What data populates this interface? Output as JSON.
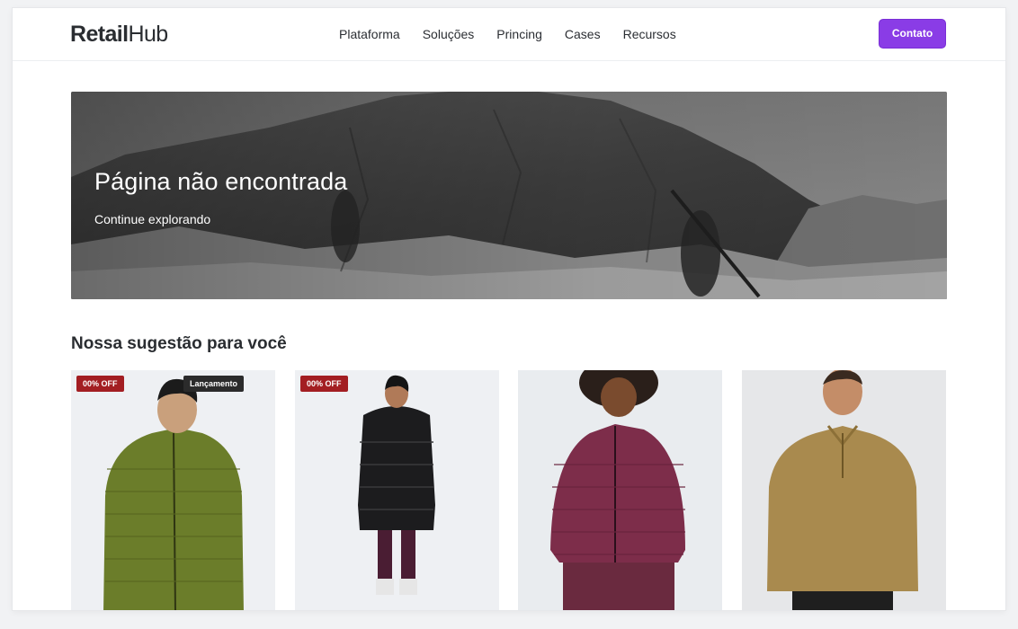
{
  "header": {
    "logo": {
      "part1": "Retail",
      "part2": "Hub"
    },
    "nav": [
      "Plataforma",
      "Soluções",
      "Princing",
      "Cases",
      "Recursos"
    ],
    "contact_label": "Contato"
  },
  "hero": {
    "title": "Página não encontrada",
    "subtitle": "Continue explorando"
  },
  "suggestions": {
    "title": "Nossa sugestão para você",
    "products": [
      {
        "badge_discount": "00% OFF",
        "badge_new": "Lançamento",
        "product_color": "#6b7d2a"
      },
      {
        "badge_discount": "00% OFF",
        "product_color": "#1c1c1e"
      },
      {
        "product_color": "#7d2d4a"
      },
      {
        "product_color": "#a98a4e"
      }
    ]
  },
  "colors": {
    "accent": "#8a3ce6",
    "badge_discount": "#a31e22",
    "badge_new": "#2b2b2b"
  }
}
